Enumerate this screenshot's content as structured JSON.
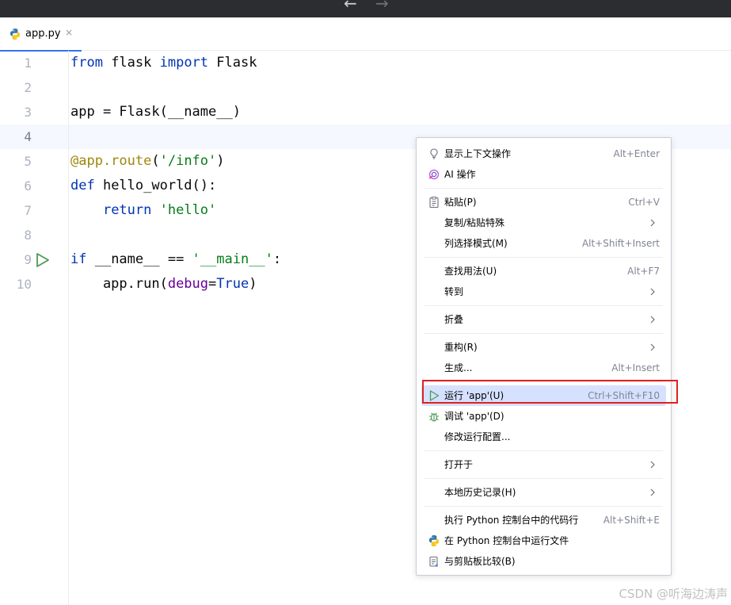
{
  "tab": {
    "filename": "app.py",
    "close": "×"
  },
  "nav": {
    "back": "←",
    "forward": "→"
  },
  "editor": {
    "lines": [
      {
        "num": "1"
      },
      {
        "num": "2"
      },
      {
        "num": "3"
      },
      {
        "num": "4"
      },
      {
        "num": "5"
      },
      {
        "num": "6"
      },
      {
        "num": "7"
      },
      {
        "num": "8"
      },
      {
        "num": "9"
      },
      {
        "num": "10"
      }
    ],
    "tokens": {
      "l1_from": "from",
      "l1_a": " flask ",
      "l1_import": "import",
      "l1_b": " Flask",
      "l3": "app = Flask(__name__)",
      "l5_dec": "@app.route",
      "l5_a": "(",
      "l5_str": "'/info'",
      "l5_b": ")",
      "l6_def": "def",
      "l6_a": " hello_world():",
      "l7_indent": "    ",
      "l7_ret": "return",
      "l7_a": " ",
      "l7_str": "'hello'",
      "l9_if": "if",
      "l9_a": " __name__ == ",
      "l9_str": "'__main__'",
      "l9_b": ":",
      "l10_a": "    app.run(",
      "l10_param": "debug",
      "l10_b": "=",
      "l10_true": "True",
      "l10_c": ")"
    }
  },
  "menu": {
    "show_context_actions": {
      "label": "显示上下文操作",
      "shortcut": "Alt+Enter"
    },
    "ai_actions": {
      "label": "AI 操作"
    },
    "paste": {
      "label": "粘贴(P)",
      "shortcut": "Ctrl+V"
    },
    "copy_paste_special": {
      "label": "复制/粘贴特殊"
    },
    "column_selection": {
      "label": "列选择模式(M)",
      "shortcut": "Alt+Shift+Insert"
    },
    "find_usages": {
      "label": "查找用法(U)",
      "shortcut": "Alt+F7"
    },
    "go_to": {
      "label": "转到"
    },
    "folding": {
      "label": "折叠"
    },
    "refactor": {
      "label": "重构(R)"
    },
    "generate": {
      "label": "生成...",
      "shortcut": "Alt+Insert"
    },
    "run_app": {
      "label": "运行 'app'(U)",
      "shortcut": "Ctrl+Shift+F10"
    },
    "debug_app": {
      "label": "调试 'app'(D)"
    },
    "modify_run_config": {
      "label": "修改运行配置..."
    },
    "open_in": {
      "label": "打开于"
    },
    "local_history": {
      "label": "本地历史记录(H)"
    },
    "exec_line_console": {
      "label": "执行 Python 控制台中的代码行",
      "shortcut": "Alt+Shift+E"
    },
    "run_file_console": {
      "label": "在 Python 控制台中运行文件"
    },
    "compare_clipboard": {
      "label": "与剪贴板比较(B)"
    }
  },
  "watermark": "CSDN @听海边涛声",
  "colors": {
    "accent": "#3574f0",
    "selection": "#d5e1ff",
    "highlight_box": "#e02020",
    "run_green": "#499c54"
  }
}
